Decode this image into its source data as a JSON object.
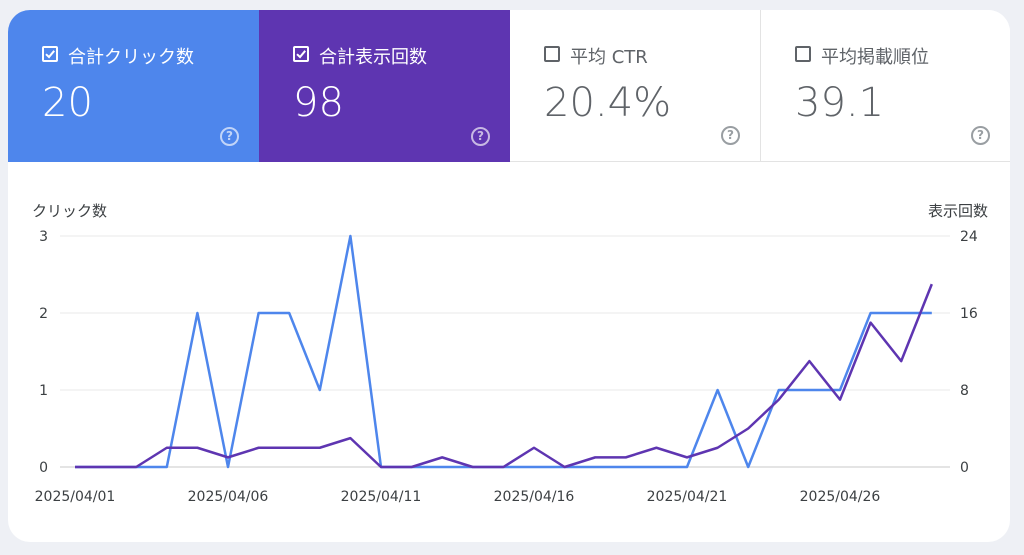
{
  "metrics": [
    {
      "label": "合計クリック数",
      "value": "20",
      "checked": true,
      "color": "#4e86ec"
    },
    {
      "label": "合計表示回数",
      "value": "98",
      "checked": true,
      "color": "#5e35b1"
    },
    {
      "label": "平均 CTR",
      "value": "20.4%",
      "checked": false,
      "color": "#ffffff"
    },
    {
      "label": "平均掲載順位",
      "value": "39.1",
      "checked": false,
      "color": "#ffffff"
    }
  ],
  "chart_data": {
    "type": "line",
    "left_axis_label": "クリック数",
    "right_axis_label": "表示回数",
    "left_ylim": [
      0,
      3
    ],
    "right_ylim": [
      0,
      24
    ],
    "left_ticks": [
      0,
      1,
      2,
      3
    ],
    "right_ticks": [
      0,
      8,
      16,
      24
    ],
    "x_ticks": [
      "2025/04/01",
      "2025/04/06",
      "2025/04/11",
      "2025/04/16",
      "2025/04/21",
      "2025/04/26"
    ],
    "x": [
      "2025/04/01",
      "2025/04/02",
      "2025/04/03",
      "2025/04/04",
      "2025/04/05",
      "2025/04/06",
      "2025/04/07",
      "2025/04/08",
      "2025/04/09",
      "2025/04/10",
      "2025/04/11",
      "2025/04/12",
      "2025/04/13",
      "2025/04/14",
      "2025/04/15",
      "2025/04/16",
      "2025/04/17",
      "2025/04/18",
      "2025/04/19",
      "2025/04/20",
      "2025/04/21",
      "2025/04/22",
      "2025/04/23",
      "2025/04/24",
      "2025/04/25",
      "2025/04/26",
      "2025/04/27",
      "2025/04/28",
      "2025/04/29"
    ],
    "series": [
      {
        "axis": "left",
        "color": "#4e86ec",
        "values": [
          0,
          0,
          0,
          0,
          2,
          0,
          2,
          2,
          1,
          3,
          0,
          0,
          0,
          0,
          0,
          0,
          0,
          0,
          0,
          0,
          0,
          1,
          0,
          1,
          1,
          1,
          2,
          2,
          2
        ]
      },
      {
        "axis": "right",
        "color": "#5e35b1",
        "values": [
          0,
          0,
          0,
          2,
          2,
          1,
          2,
          2,
          2,
          3,
          0,
          0,
          1,
          0,
          0,
          2,
          0,
          1,
          1,
          2,
          1,
          2,
          4,
          7,
          11,
          7,
          15,
          11,
          19
        ]
      }
    ],
    "grid": true
  }
}
